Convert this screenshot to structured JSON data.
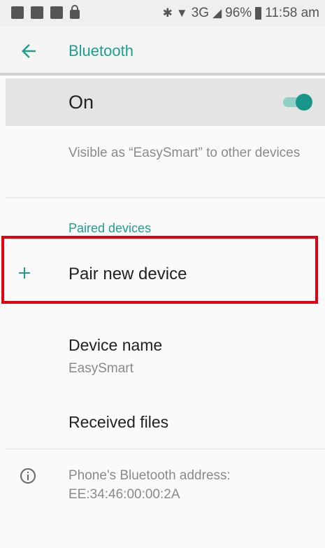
{
  "status_bar": {
    "icons": [
      "image-icon",
      "image-icon",
      "image-icon",
      "lock-icon"
    ],
    "bluetooth_glyph": "✱",
    "wifi_glyph": "▼",
    "network": "3G",
    "signal_glyph": "◢",
    "battery": "96%",
    "time": "11:58 am"
  },
  "app_bar": {
    "title": "Bluetooth",
    "back_icon": "arrow-back-icon"
  },
  "bluetooth_toggle": {
    "label": "On",
    "state": true,
    "accent_color": "#18968a"
  },
  "visible_text": "Visible as “EasySmart” to other devices",
  "paired_section": {
    "header": "Paired devices",
    "pair_new_label": "Pair new device",
    "plus_icon": "plus-icon"
  },
  "highlight": {
    "color": "#e30010",
    "target": "Pair new device"
  },
  "device_name": {
    "title": "Device name",
    "value": "EasySmart"
  },
  "received_files": {
    "label": "Received files"
  },
  "address": {
    "icon": "info-icon",
    "text": "Phone's Bluetooth address: EE:34:46:00:00:2A"
  }
}
